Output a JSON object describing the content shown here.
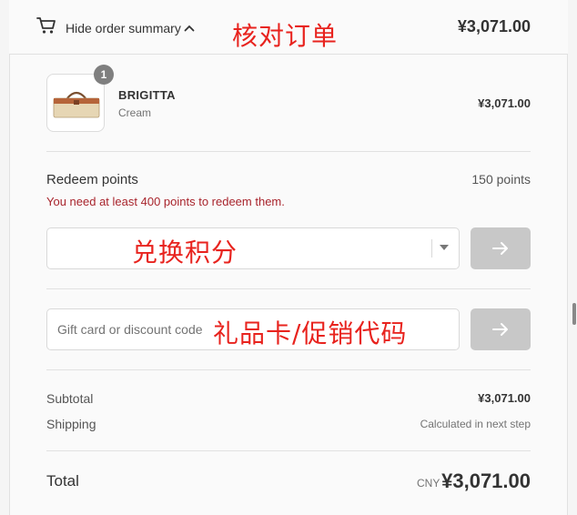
{
  "summary": {
    "toggle_label": "Hide order summary",
    "header_total": "¥3,071.00",
    "annotation": "核对订单"
  },
  "product": {
    "quantity": "1",
    "name": "BRIGITTA",
    "variant": "Cream",
    "price": "¥3,071.00"
  },
  "redeem": {
    "title": "Redeem points",
    "points": "150 points",
    "error": "You need at least 400 points to redeem them.",
    "annotation": "兑换积分"
  },
  "discount": {
    "placeholder": "Gift card or discount code",
    "annotation": "礼品卡/促销代码"
  },
  "totals": {
    "subtotal_label": "Subtotal",
    "subtotal_value": "¥3,071.00",
    "shipping_label": "Shipping",
    "shipping_value": "Calculated in next step",
    "total_label": "Total",
    "currency": "CNY",
    "total_value": "¥3,071.00"
  },
  "colors": {
    "annotation": "#e8231e",
    "error": "#a8242c",
    "button_disabled": "#c8c8c8"
  },
  "icons": [
    "cart-icon",
    "chevron-up-icon",
    "chevron-down-icon",
    "arrow-right-icon"
  ]
}
